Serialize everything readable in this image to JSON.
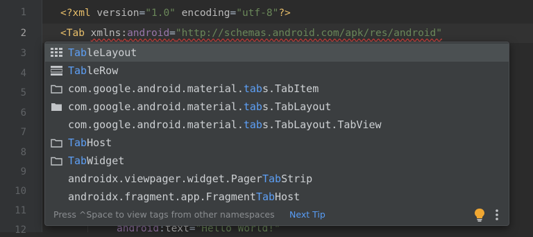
{
  "gutter": {
    "lines": [
      "1",
      "2",
      "3",
      "4",
      "5",
      "6",
      "7",
      "8",
      "9",
      "10",
      "11",
      "12"
    ]
  },
  "code": {
    "line1": {
      "open": "<?",
      "name": "xml",
      "attr1": "version",
      "val1": "\"1.0\"",
      "attr2": "encoding",
      "val2": "\"utf-8\"",
      "close": "?>"
    },
    "line2": {
      "open": "<",
      "typed": "Tab",
      "ns_attr": "xmlns",
      "ns_colon": ":",
      "ns_name": "android",
      "eq": "=",
      "ns_value": "\"http://schemas.android.com/apk/res/android\""
    },
    "line12": {
      "prefix": "android",
      "colon": ":",
      "attr": "text",
      "eq": "=",
      "value": "\"Hello World!\""
    }
  },
  "completion": {
    "items": [
      {
        "match": "Tab",
        "rest": "leLayout",
        "icon": "layout-grid-icon",
        "prefix": "",
        "suffix": ""
      },
      {
        "match": "Tab",
        "rest": "leRow",
        "icon": "table-row-icon",
        "prefix": "",
        "suffix": ""
      },
      {
        "prefix": "com.google.android.material.",
        "match": "tab",
        "suffix": "s.TabItem",
        "icon": "folder-outline-icon"
      },
      {
        "prefix": "com.google.android.material.",
        "match": "tab",
        "suffix": "s.TabLayout",
        "icon": "folder-filled-icon"
      },
      {
        "prefix": "com.google.android.material.",
        "match": "tab",
        "suffix": "s.TabLayout.TabView",
        "icon": ""
      },
      {
        "match": "Tab",
        "rest": "Host",
        "icon": "folder-outline-icon",
        "prefix": "",
        "suffix": ""
      },
      {
        "match": "Tab",
        "rest": "Widget",
        "icon": "folder-outline-icon",
        "prefix": "",
        "suffix": ""
      },
      {
        "prefix": "androidx.viewpager.widget.Pager",
        "match": "Tab",
        "suffix": "Strip",
        "icon": ""
      },
      {
        "prefix": "androidx.fragment.app.Fragment",
        "match": "Tab",
        "suffix": "Host",
        "icon": ""
      }
    ],
    "footer": {
      "hint": "Press ^Space to view tags from other namespaces",
      "next_tip": "Next Tip"
    }
  },
  "colors": {
    "match_highlight": "#5d9ff5",
    "background": "#2b2b2b",
    "popup": "#3b3e40"
  }
}
